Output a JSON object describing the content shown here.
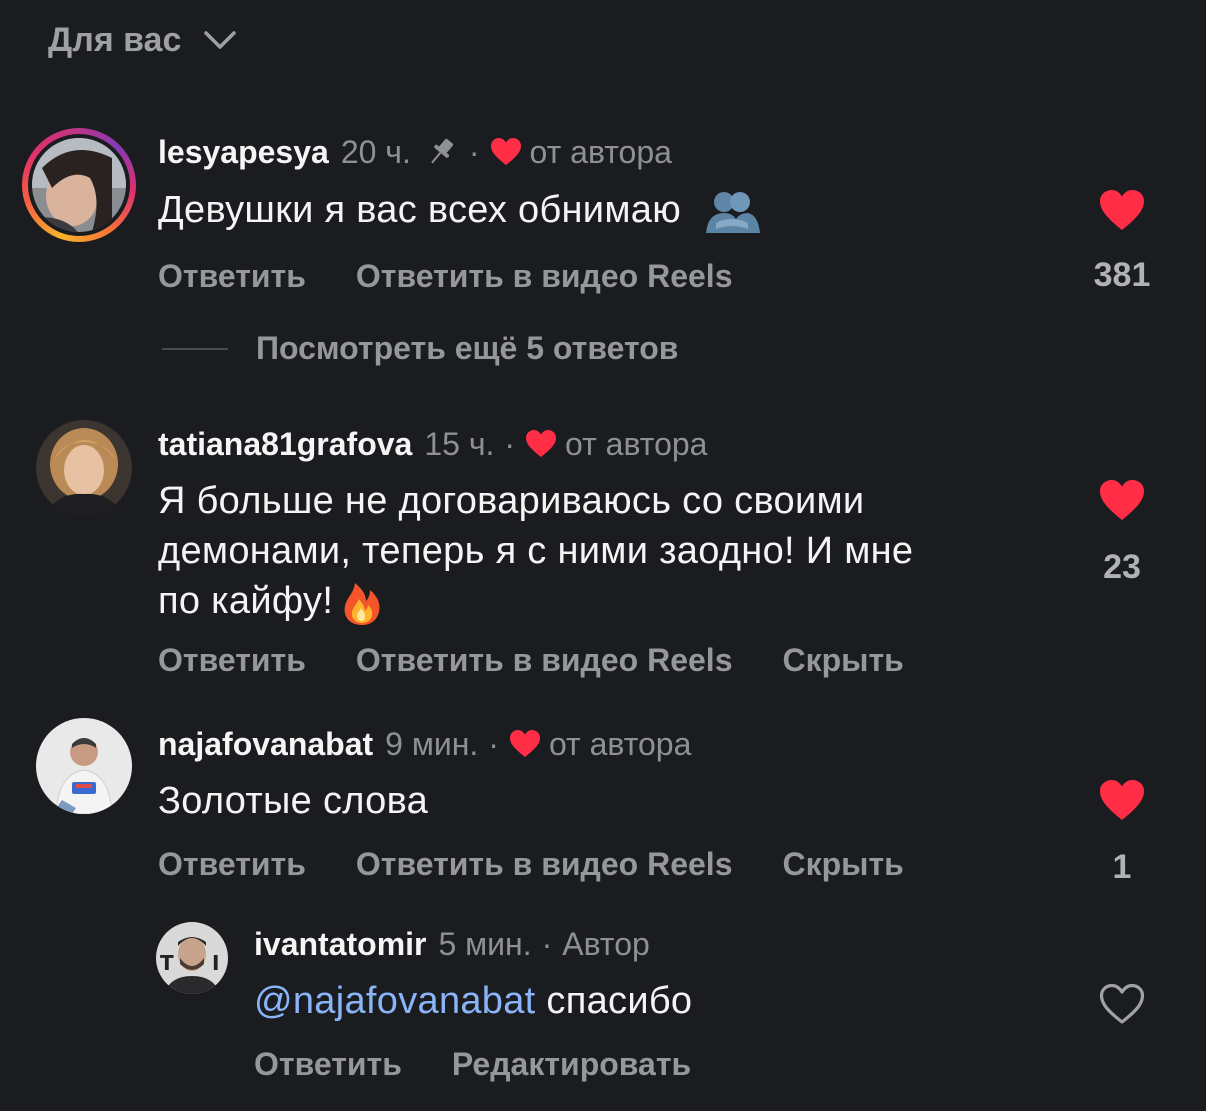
{
  "header": {
    "title": "Для вас"
  },
  "comments": [
    {
      "username": "lesyapesya",
      "time": "20 ч.",
      "pinned": true,
      "author_liked": "от автора",
      "text": "Девушки я вас всех обнимаю",
      "emoji": "people-hugging-emoji",
      "actions": [
        "Ответить",
        "Ответить в видео Reels"
      ],
      "likes": "381",
      "liked": true,
      "view_more": "Посмотреть ещё 5 ответов"
    },
    {
      "username": "tatiana81grafova",
      "time": "15 ч.",
      "author_liked": "от автора",
      "text_lines": [
        "Я больше не договариваюсь со своими",
        "демонами, теперь я с ними заодно! И мне",
        "по кайфу!"
      ],
      "emoji": "fire-emoji",
      "actions": [
        "Ответить",
        "Ответить в видео Reels",
        "Скрыть"
      ],
      "likes": "23",
      "liked": true
    },
    {
      "username": "najafovanabat",
      "time": "9 мин.",
      "author_liked": "от автора",
      "text": "Золотые слова",
      "actions": [
        "Ответить",
        "Ответить в видео Reels",
        "Скрыть"
      ],
      "likes": "1",
      "liked": true
    },
    {
      "username": "ivantatomir",
      "time": "5 мин.",
      "role": "Автор",
      "mention": "@najafovanabat",
      "text": "спасибо",
      "actions": [
        "Ответить",
        "Редактировать"
      ],
      "liked": false
    }
  ],
  "separator": "·",
  "colors": {
    "background": "#1b1c20",
    "heart_red": "#ff2d45",
    "mention_blue": "#8ab4f8",
    "muted": "#95979d"
  }
}
